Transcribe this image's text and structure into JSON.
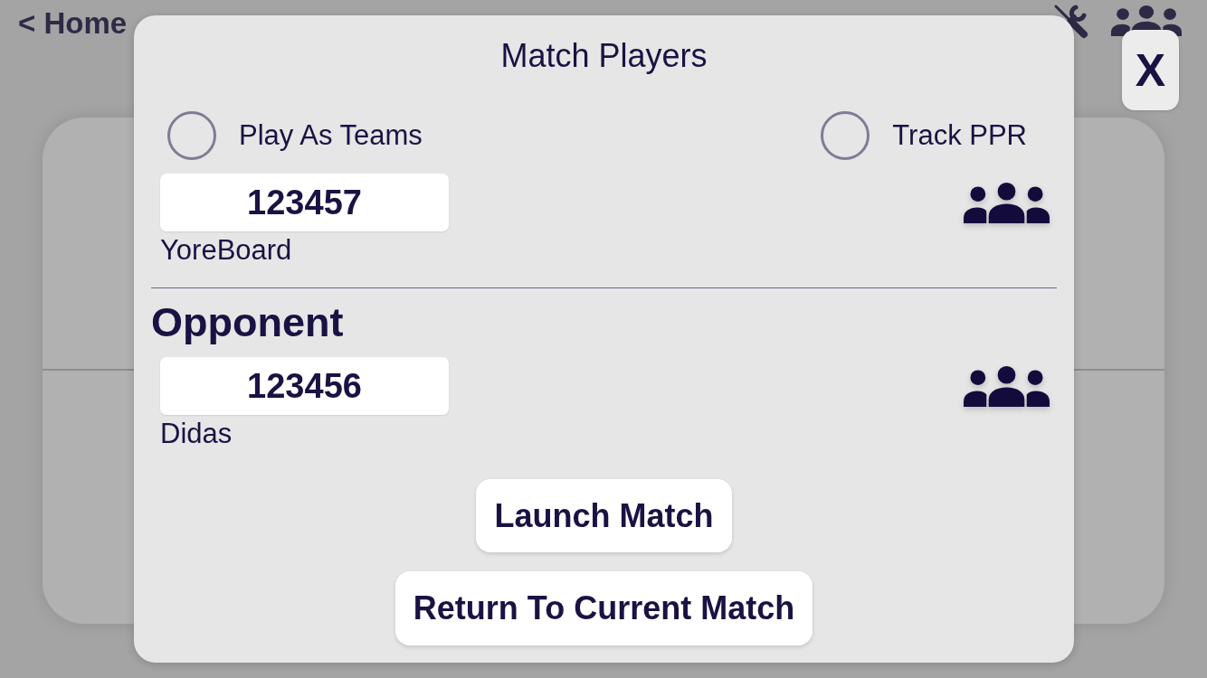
{
  "header": {
    "back_link": "< Home"
  },
  "close_button": "X",
  "dialog": {
    "title": "Match Players",
    "options": [
      {
        "label": "Play As Teams",
        "checked": false
      },
      {
        "label": "Track PPR",
        "checked": false
      }
    ],
    "players": [
      {
        "id": "123457",
        "name": "YoreBoard"
      },
      {
        "heading": "Opponent",
        "id": "123456",
        "name": "Didas"
      }
    ],
    "buttons": [
      "Launch Match",
      "Return To Current Match"
    ]
  }
}
